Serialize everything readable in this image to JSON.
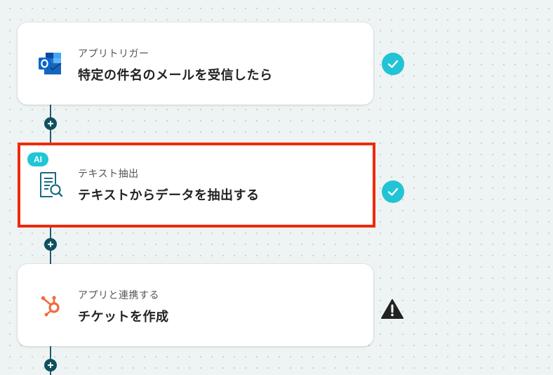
{
  "steps": [
    {
      "category": "アプリトリガー",
      "title": "特定の件名のメールを受信したら",
      "icon": "outlook-icon",
      "status": "complete"
    },
    {
      "category": "テキスト抽出",
      "title": "テキストからデータを抽出する",
      "icon": "document-search-icon",
      "badge": "AI",
      "status": "complete",
      "selected": true
    },
    {
      "category": "アプリと連携する",
      "title": "チケットを作成",
      "icon": "hubspot-icon",
      "status": "warning"
    }
  ],
  "colors": {
    "accent": "#22c3d5",
    "selected_border": "#ee2a0c",
    "connector": "#0f4f5f",
    "hubspot": "#f26a3d",
    "outlook": "#0a64c8"
  }
}
